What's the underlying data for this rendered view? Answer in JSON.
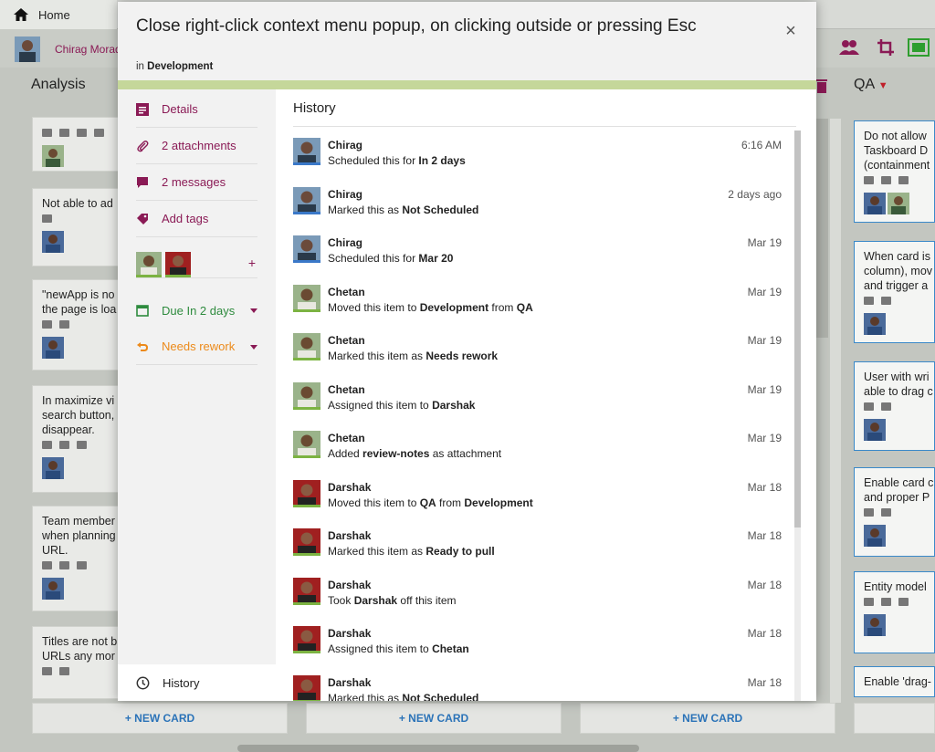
{
  "app": {
    "home_label": "Home",
    "user_name": "Chirag Morad"
  },
  "board": {
    "columns": [
      {
        "title": "Analysis"
      },
      {
        "title": "QA"
      }
    ],
    "analysis_cards": [
      "",
      "Not able to ad",
      "\"newApp is no\nthe page is loa",
      "In maximize vi\nsearch button,\ndisappear.",
      "Team member\nwhen planning\nURL.",
      "Titles are not b\nURLs any mor"
    ],
    "qa_cards": [
      "Do not allow\nTaskboard D\n(containment",
      "When card is\ncolumn), mov\nand trigger a",
      "User with wri\nable to drag c",
      "Enable card c\nand proper P",
      "Entity model",
      "Enable 'drag-"
    ],
    "new_card_label": "+ NEW CARD"
  },
  "modal": {
    "title": "Close right-click context menu popup, on clicking outside or pressing Esc",
    "in_label": "in",
    "column_name": "Development",
    "close_icon": "×",
    "accent_color": "#c5d79a",
    "sidebar": {
      "details": "Details",
      "attachments": "2 attachments",
      "messages": "2 messages",
      "tags": "Add tags",
      "add_member": "+",
      "due": "Due In 2 days",
      "status": "Needs rework",
      "history": "History"
    },
    "history": {
      "title": "History",
      "entries": [
        {
          "name": "Chirag",
          "pre": "Scheduled this for ",
          "b1": "In 2 days",
          "mid": "",
          "b2": "",
          "time": "6:16 AM",
          "user": "chirag"
        },
        {
          "name": "Chirag",
          "pre": "Marked this as ",
          "b1": "Not Scheduled",
          "mid": "",
          "b2": "",
          "time": "2 days ago",
          "user": "chirag"
        },
        {
          "name": "Chirag",
          "pre": "Scheduled this for ",
          "b1": "Mar 20",
          "mid": "",
          "b2": "",
          "time": "Mar 19",
          "user": "chirag"
        },
        {
          "name": "Chetan",
          "pre": "Moved this item to ",
          "b1": "Development",
          "mid": " from ",
          "b2": "QA",
          "time": "Mar 19",
          "user": "chetan"
        },
        {
          "name": "Chetan",
          "pre": "Marked this item as ",
          "b1": "Needs rework",
          "mid": "",
          "b2": "",
          "time": "Mar 19",
          "user": "chetan"
        },
        {
          "name": "Chetan",
          "pre": "Assigned this item to ",
          "b1": "Darshak",
          "mid": "",
          "b2": "",
          "time": "Mar 19",
          "user": "chetan"
        },
        {
          "name": "Chetan",
          "pre": "Added ",
          "b1": "review-notes",
          "mid": " as attachment",
          "b2": "",
          "time": "Mar 19",
          "user": "chetan"
        },
        {
          "name": "Darshak",
          "pre": "Moved this item to ",
          "b1": "QA",
          "mid": " from ",
          "b2": "Development",
          "time": "Mar 18",
          "user": "darshak"
        },
        {
          "name": "Darshak",
          "pre": "Marked this item as ",
          "b1": "Ready to pull",
          "mid": "",
          "b2": "",
          "time": "Mar 18",
          "user": "darshak"
        },
        {
          "name": "Darshak",
          "pre": "Took ",
          "b1": "Darshak",
          "mid": " off this item",
          "b2": "",
          "time": "Mar 18",
          "user": "darshak"
        },
        {
          "name": "Darshak",
          "pre": "Assigned this item to ",
          "b1": "Chetan",
          "mid": "",
          "b2": "",
          "time": "Mar 18",
          "user": "darshak"
        },
        {
          "name": "Darshak",
          "pre": "Marked this as ",
          "b1": "Not Scheduled",
          "mid": "",
          "b2": "",
          "time": "Mar 18",
          "user": "darshak"
        }
      ]
    }
  }
}
